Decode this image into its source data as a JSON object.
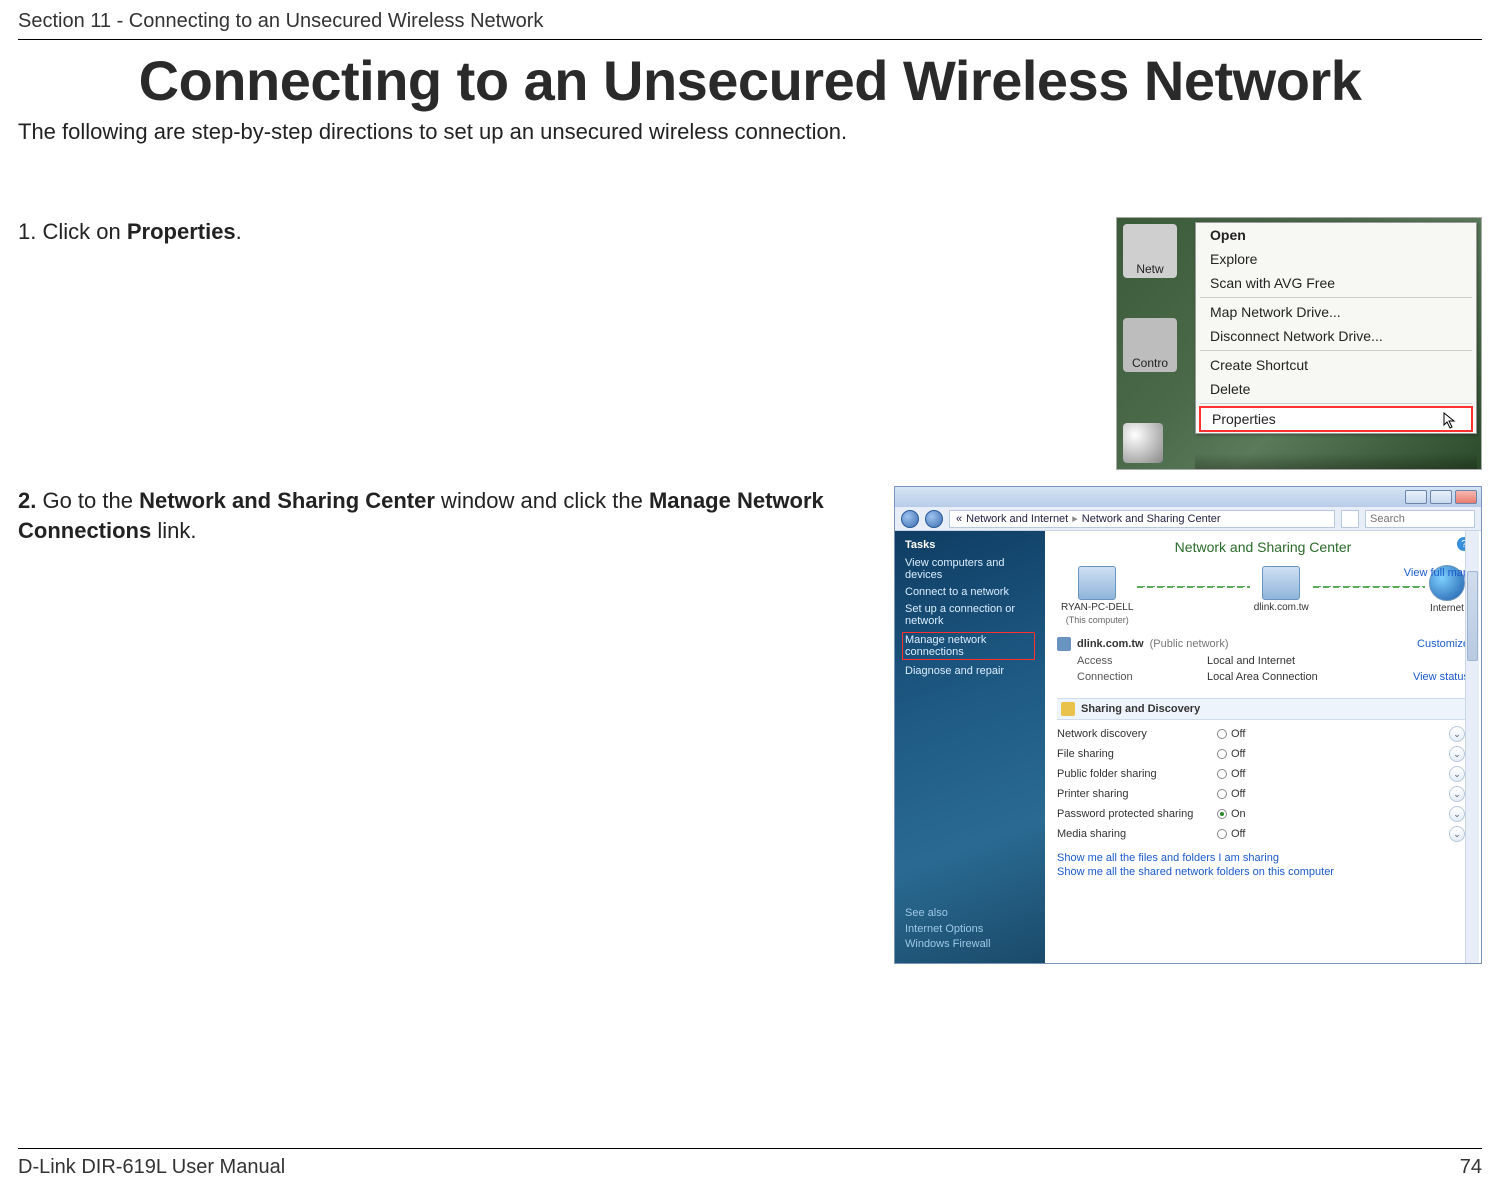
{
  "header": {
    "section": "Section 11 - Connecting to an Unsecured Wireless Network"
  },
  "title": "Connecting to an Unsecured Wireless Network",
  "intro": "The following are step-by-step directions to set up an unsecured wireless connection.",
  "steps": {
    "s1": {
      "num": "1.",
      "pre": " Click on ",
      "bold": "Properties",
      "post": "."
    },
    "s2": {
      "num": "2.",
      "pre": " Go to the ",
      "bold1": "Network and Sharing Center",
      "mid": " window and click the ",
      "bold2": "Manage Network Connections",
      "post": " link."
    }
  },
  "ctx": {
    "icon_netw": "Netw",
    "icon_cp": "Contro",
    "items": {
      "open": "Open",
      "explore": "Explore",
      "scan_avg": "Scan with AVG Free",
      "map_drive": "Map Network Drive...",
      "disconnect_drive": "Disconnect Network Drive...",
      "create_shortcut": "Create Shortcut",
      "delete": "Delete",
      "properties": "Properties"
    }
  },
  "nsc": {
    "addr": {
      "seg1": "Network and Internet",
      "seg2": "Network and Sharing Center",
      "search_ph": "Search"
    },
    "tasks": {
      "head": "Tasks",
      "view_cd": "View computers and devices",
      "connect": "Connect to a network",
      "setup": "Set up a connection or network",
      "manage": "Manage network connections",
      "diagnose": "Diagnose and repair"
    },
    "see_also": {
      "head": "See also",
      "io": "Internet Options",
      "wf": "Windows Firewall"
    },
    "main": {
      "title": "Network and Sharing Center",
      "full_map": "View full map",
      "nodes": {
        "pc": "RYAN-PC-DELL",
        "pc_sub": "(This computer)",
        "router": "dlink.com.tw",
        "internet": "Internet"
      },
      "network": {
        "name": "dlink.com.tw",
        "type": "(Public network)",
        "customize": "Customize",
        "access_lbl": "Access",
        "access_val": "Local and Internet",
        "conn_lbl": "Connection",
        "conn_val": "Local Area Connection",
        "view_status": "View status"
      },
      "sd_head": "Sharing and Discovery",
      "sd": {
        "nd": {
          "lbl": "Network discovery",
          "val": "Off"
        },
        "fs": {
          "lbl": "File sharing",
          "val": "Off"
        },
        "pfs": {
          "lbl": "Public folder sharing",
          "val": "Off"
        },
        "ps": {
          "lbl": "Printer sharing",
          "val": "Off"
        },
        "pps": {
          "lbl": "Password protected sharing",
          "val": "On"
        },
        "ms": {
          "lbl": "Media sharing",
          "val": "Off"
        }
      },
      "show1": "Show me all the files and folders I am sharing",
      "show2": "Show me all the shared network folders on this computer"
    },
    "help": "?"
  },
  "footer": {
    "manual": "D-Link DIR-619L User Manual",
    "page": "74"
  }
}
